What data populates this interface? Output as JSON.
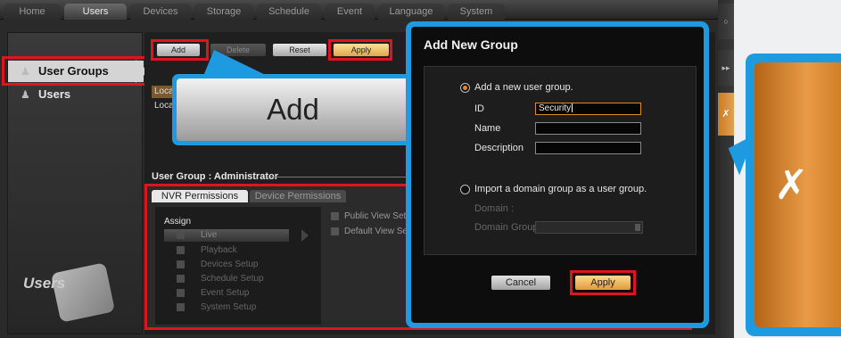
{
  "top_tabs": [
    "Home",
    "Users",
    "Devices",
    "Storage",
    "Schedule",
    "Event",
    "Language",
    "System"
  ],
  "active_top_tab": "Users",
  "sidebar": {
    "items": [
      {
        "label": "User Groups",
        "icon": "user-group-icon",
        "selected": true
      },
      {
        "label": "Users",
        "icon": "user-icon",
        "selected": false
      }
    ],
    "logo_text": "Users"
  },
  "toolbar": {
    "add_label": "Add",
    "delete_label": "Delete",
    "reset_label": "Reset",
    "apply_label": "Apply"
  },
  "group_list": [
    "Loca",
    "Loca"
  ],
  "zoom_add_label": "Add",
  "user_group": {
    "title": "User Group : Administrator",
    "tabs": [
      "NVR Permissions",
      "Device Permissions"
    ],
    "assign_label": "Assign",
    "permissions": [
      "Live",
      "Playback",
      "Devices Setup",
      "Schedule Setup",
      "Event Setup",
      "System Setup"
    ],
    "view_options": [
      "Public View Set",
      "Default View Se"
    ]
  },
  "dialog": {
    "title": "Add New Group",
    "option_add": "Add a new user group.",
    "id_label": "ID",
    "id_value": "Security",
    "name_label": "Name",
    "name_value": "",
    "description_label": "Description",
    "description_value": "",
    "option_import": "Import a domain group as a user group.",
    "domain_label": "Domain :",
    "domain_group_label": "Domain Group",
    "cancel_label": "Cancel",
    "apply_label": "Apply"
  },
  "colors": {
    "callout_blue": "#1d9ae0",
    "highlight_red": "#e0141e",
    "accent_orange": "#e08a2a"
  }
}
